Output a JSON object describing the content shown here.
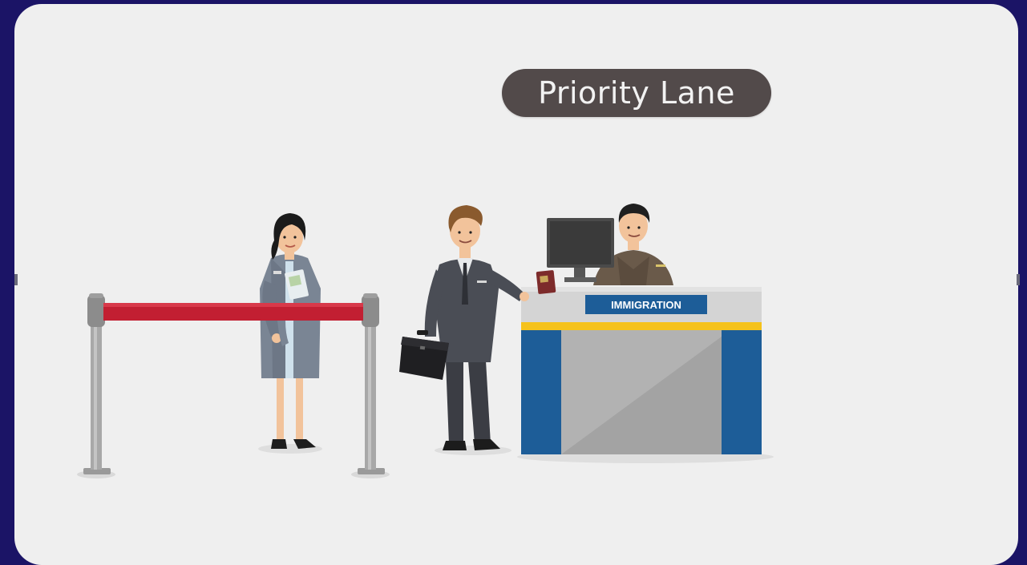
{
  "scene": {
    "banner_label": "Priority Lane",
    "desk_sign": "IMMIGRATION"
  },
  "colors": {
    "background": "#1b1466",
    "panel": "#efefef",
    "banner": "#524a4a",
    "rope": "#c21f32",
    "desk_blue": "#1d5d98",
    "desk_yellow": "#f5c21b"
  },
  "icons": [
    "stanchion",
    "woman-traveller",
    "businessman",
    "briefcase",
    "passport",
    "monitor",
    "immigration-officer",
    "immigration-desk"
  ]
}
